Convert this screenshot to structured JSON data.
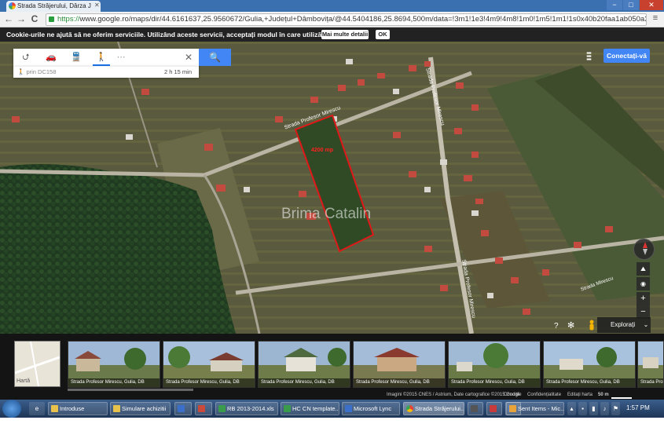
{
  "browser": {
    "tab_title": "Strada Străjerului, Dârza J",
    "url_scheme": "https://",
    "url_rest": "www.google.ro/maps/dir/44.6161637,25.9560672/Gulia,+Județul+Dâmbovița/@44.5404186,25.8694,500m/data=!3m1!1e3!4m9!4m8!1m0!1m5!1m1!1s0x40b20faa1ab050a3",
    "back_icon": "←",
    "forward_icon": "→",
    "reload_icon": "C",
    "menu_icon": "≡",
    "win_min": "−",
    "win_max": "□",
    "win_close": "✕"
  },
  "cookie_bar": {
    "message": "Cookie-urile ne ajută să ne oferim serviciile. Utilizând aceste servicii, acceptați modul în care utilizăm cookie-urile.",
    "more_label": "Mai multe detalii",
    "ok_label": "OK"
  },
  "directions": {
    "modes": [
      "⮍",
      "🚗",
      "🚆",
      "🚶",
      "⋯"
    ],
    "close": "✕",
    "search": "🔍",
    "route_via": "prin DC158",
    "route_time": "2 h 15 min"
  },
  "top_right": {
    "apps": "⋮⋮⋮",
    "signin": "Conectați-vă"
  },
  "map": {
    "parcel_label": "4200 mp",
    "watermark": "Brima Catalin",
    "streets": [
      "Strada Profesor Mirescu",
      "Strada Profesor Mirescu",
      "Strada Profesor Mirescu",
      "Strada Mirescu"
    ],
    "compass": "",
    "controls": [
      "⛰",
      "◉",
      "+",
      "−"
    ],
    "help": "?",
    "gear": "✻",
    "explore_label": "Explorați",
    "explore_chev": "⌄"
  },
  "filmstrip": {
    "map_label": "Hartă",
    "photos": [
      {
        "caption": "Strada Profesor Mirescu, Gulia, DB"
      },
      {
        "caption": "Strada Profesor Mirescu, Gulia, DB"
      },
      {
        "caption": "Strada Profesor Mirescu, Gulia, DB"
      },
      {
        "caption": "Strada Profesor Mirescu, Gulia, DB"
      },
      {
        "caption": "Strada Profesor Mirescu, Gulia, DB"
      },
      {
        "caption": "Strada Profesor Mirescu, Gulia, DB"
      },
      {
        "caption": "Strada Pro"
      }
    ]
  },
  "footer": {
    "imagery": "Imagini ©2015 CNES / Astrium, Date cartografice ©2015 Google",
    "terms": "Condiții",
    "privacy": "Confidențialitate",
    "edit": "Editați harta",
    "scale": "50 m"
  },
  "taskbar": {
    "tasks": [
      {
        "label": "Introduse",
        "color": "#e8c24a"
      },
      {
        "label": "Simulare achizitii",
        "color": "#e8c24a"
      },
      {
        "label": "",
        "color": "#3b6fc9"
      },
      {
        "label": "",
        "color": "#c94a3b"
      },
      {
        "label": "RB 2013-2014.xls",
        "color": "#3a9b4a"
      },
      {
        "label": "HC CN template...",
        "color": "#3a9b4a"
      },
      {
        "label": "Microsoft Lync",
        "color": "#3b6fc9"
      },
      {
        "label": "Strada Străjerului...",
        "color": "#e04a3a"
      },
      {
        "label": "",
        "color": "#555"
      },
      {
        "label": "",
        "color": "#c93b3b"
      },
      {
        "label": "",
        "color": "#3b6fc9"
      },
      {
        "label": "Sent Items - Mic...",
        "color": "#e8a23a"
      }
    ],
    "clock": "1:57 PM"
  }
}
